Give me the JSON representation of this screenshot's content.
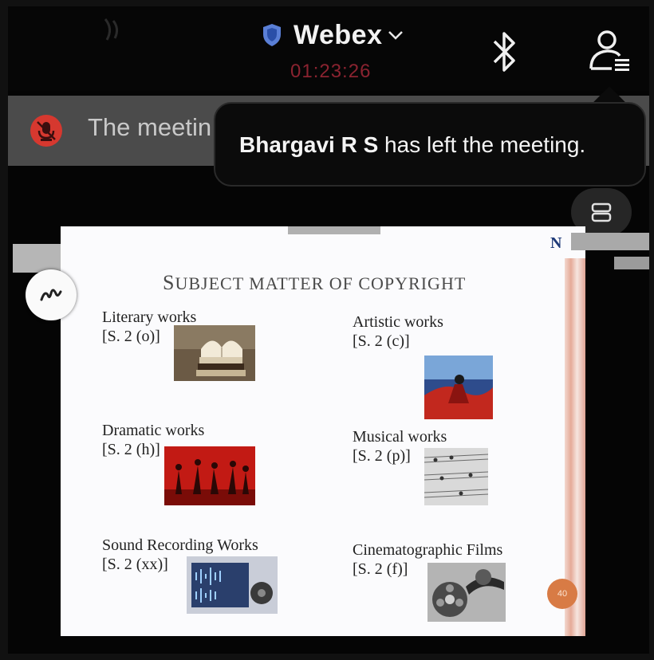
{
  "header": {
    "app_title": "Webex",
    "timer": "01:23:26"
  },
  "notification_strip": {
    "text": "The meetin"
  },
  "toast": {
    "name": "Bhargavi R S",
    "message": " has left the meeting."
  },
  "slide": {
    "logo": "N",
    "title_first": "S",
    "title_rest": "UBJECT MATTER OF COPYRIGHT",
    "page_number": "40",
    "items": [
      {
        "label": "Literary works",
        "section": "[S. 2 (o)]",
        "image": "books-image"
      },
      {
        "label": "Artistic works",
        "section": "[S. 2 (c)]",
        "image": "painting-image"
      },
      {
        "label": "Dramatic works",
        "section": "[S. 2 (h)]",
        "image": "dancers-image"
      },
      {
        "label": "Musical works",
        "section": "[S. 2 (p)]",
        "image": "sheet-music-image"
      },
      {
        "label": "Sound Recording Works",
        "section": "[S. 2 (xx)]",
        "image": "audio-waveform-image"
      },
      {
        "label": "Cinematographic Films",
        "section": "[S. 2 (f)]",
        "image": "film-reel-image"
      }
    ]
  },
  "colors": {
    "timer": "#8a2330",
    "mute_badge": "#d6382f",
    "shield": "#5a7fd6",
    "page_badge": "#d87b45"
  }
}
